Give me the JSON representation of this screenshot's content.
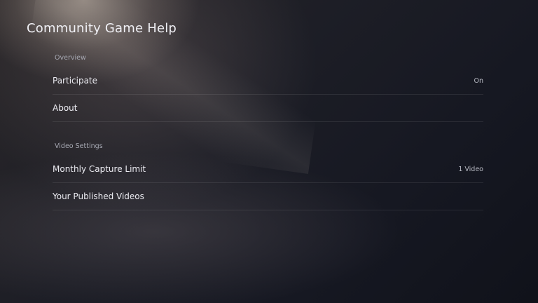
{
  "page": {
    "title": "Community Game Help"
  },
  "sections": [
    {
      "header": "Overview",
      "items": [
        {
          "label": "Participate",
          "value": "On"
        },
        {
          "label": "About",
          "value": ""
        }
      ]
    },
    {
      "header": "Video Settings",
      "items": [
        {
          "label": "Monthly Capture Limit",
          "value": "1 Video"
        },
        {
          "label": "Your Published Videos",
          "value": ""
        }
      ]
    }
  ]
}
